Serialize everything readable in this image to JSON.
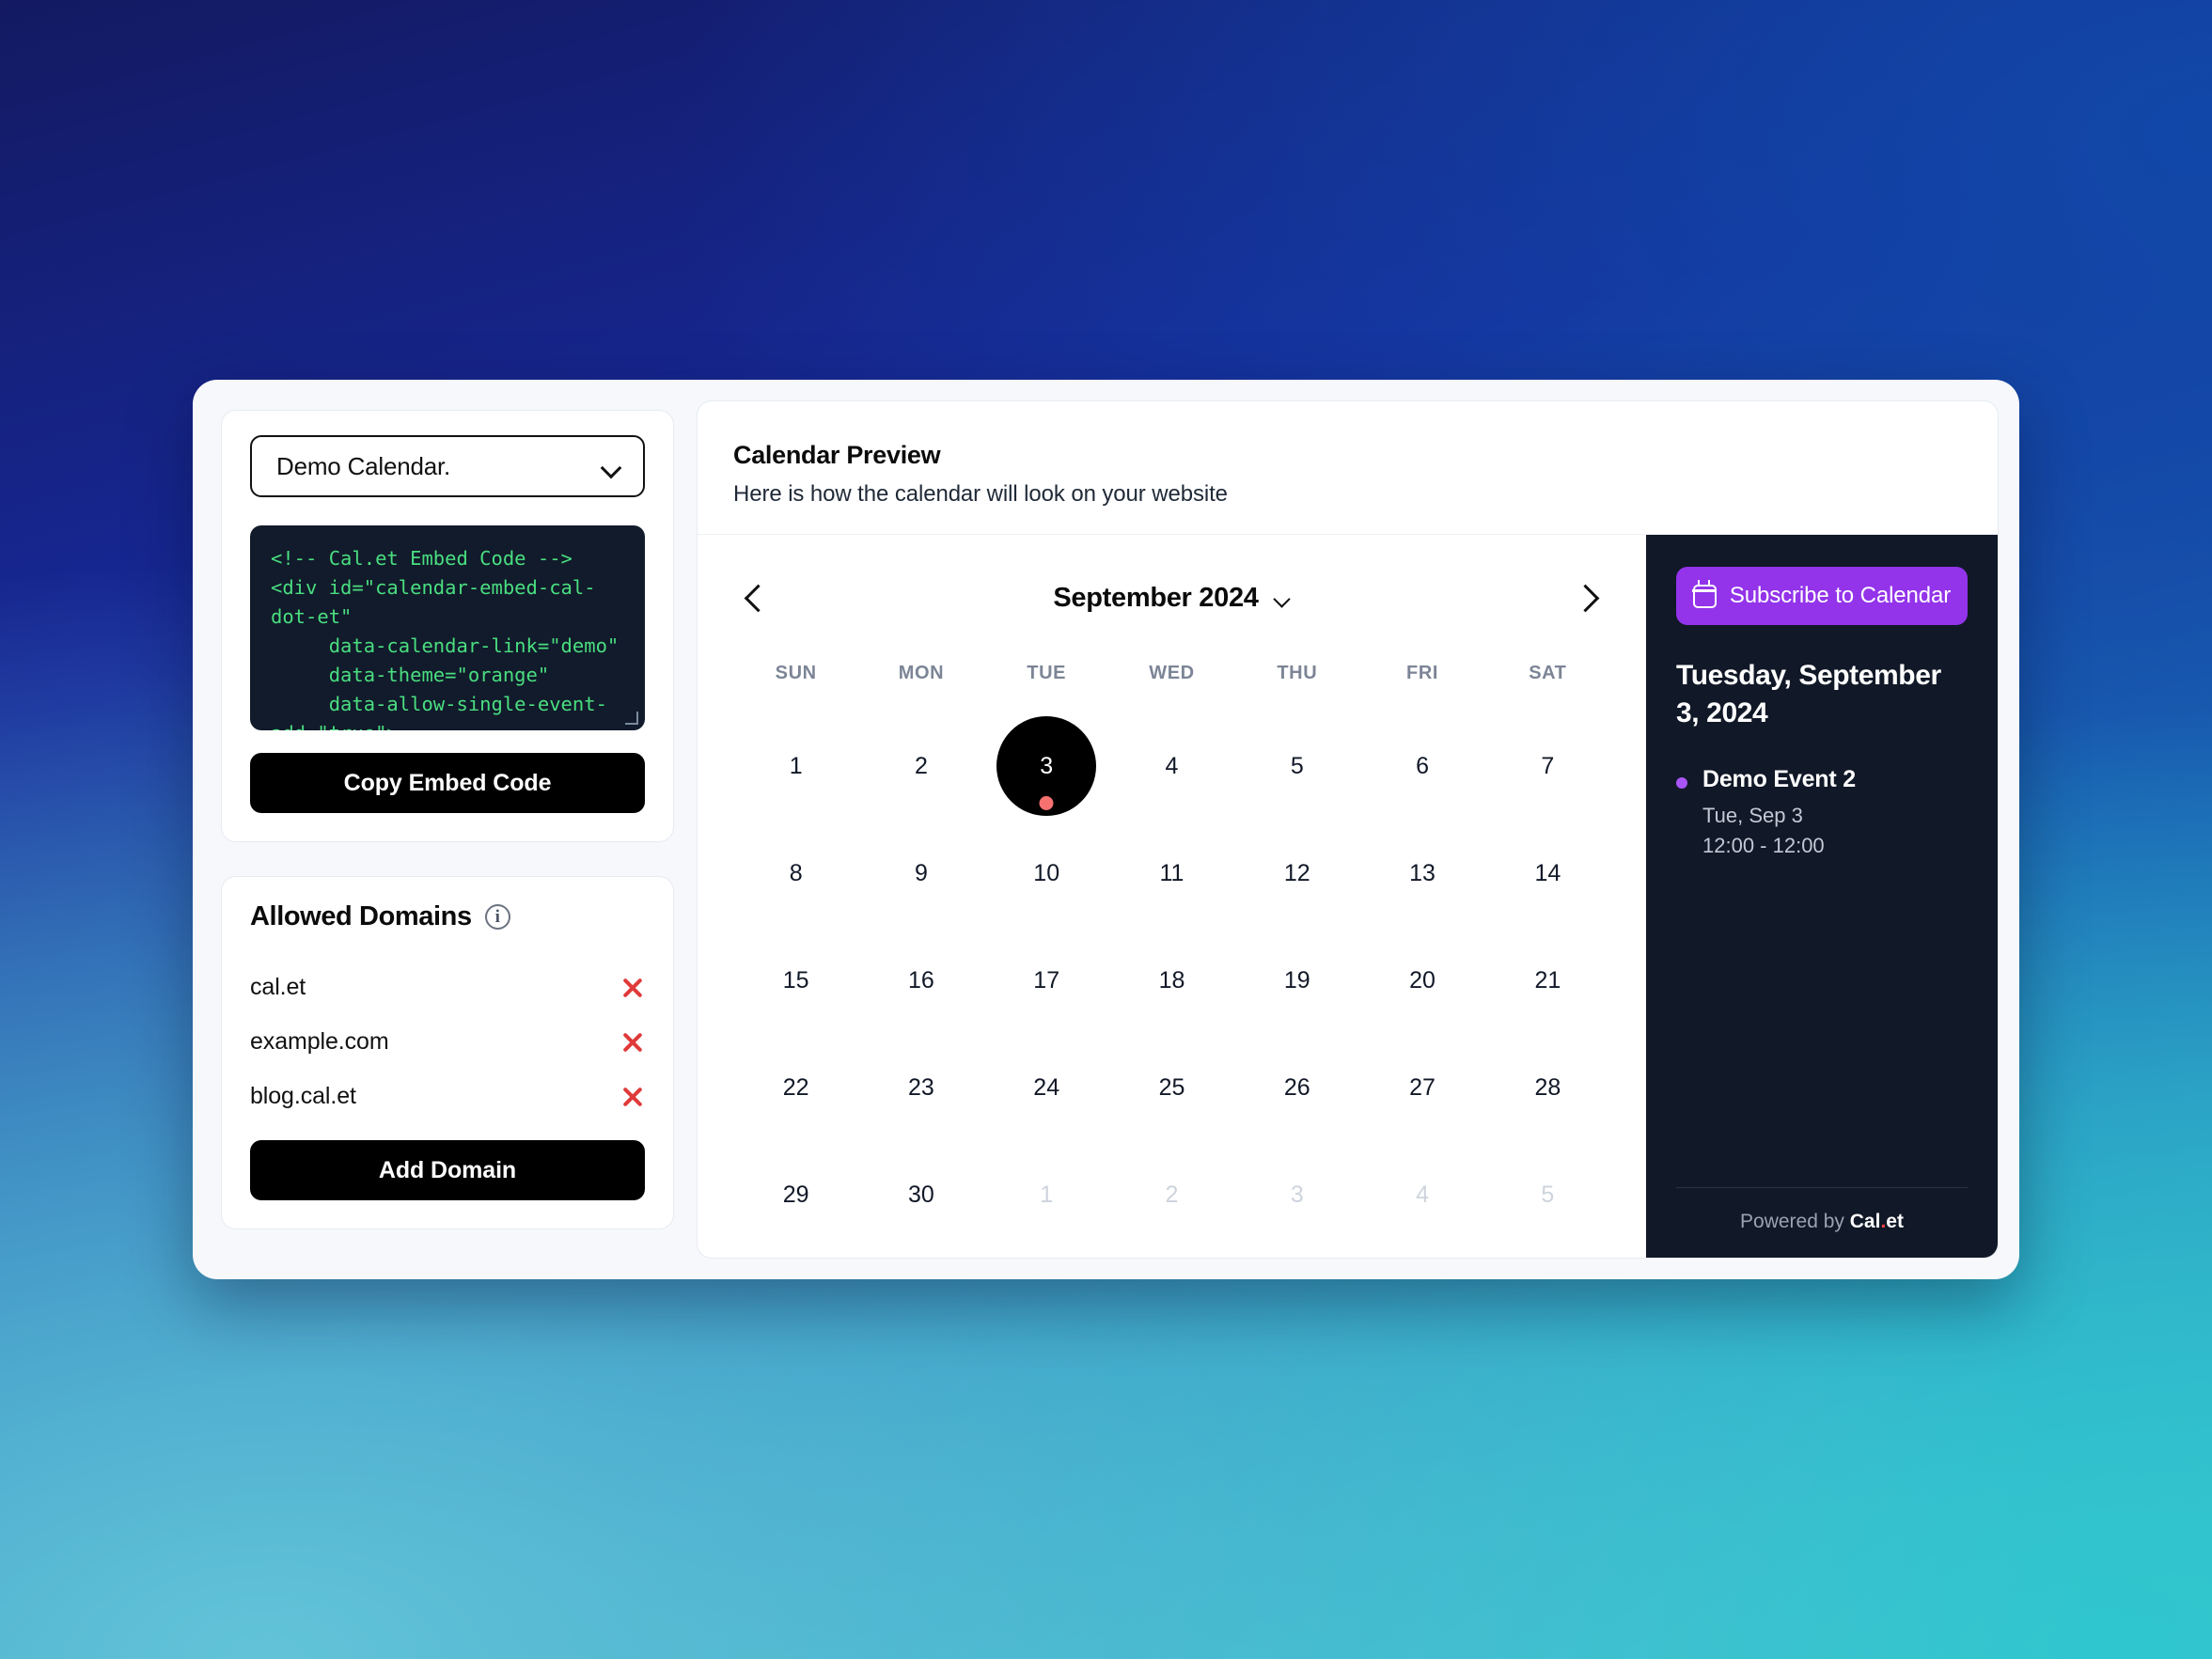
{
  "background": {
    "gradient_from": "#131a62",
    "gradient_via": "#1148a8",
    "gradient_to": "#3cc2cb"
  },
  "sidebar": {
    "calendar_select": {
      "value": "Demo Calendar.",
      "chevron_icon": "chevron-down-icon"
    },
    "embed_code": "<!-- Cal.et Embed Code -->\n<div id=\"calendar-embed-cal-\ndot-et\"\n     data-calendar-link=\"demo\"\n     data-theme=\"orange\"\n     data-allow-single-event-\nadd=\"true\">",
    "copy_button_label": "Copy Embed Code",
    "allowed_domains": {
      "title": "Allowed Domains",
      "info_icon": "info-icon",
      "items": [
        {
          "domain": "cal.et",
          "remove_icon": "x-icon"
        },
        {
          "domain": "example.com",
          "remove_icon": "x-icon"
        },
        {
          "domain": "blog.cal.et",
          "remove_icon": "x-icon"
        }
      ],
      "add_button_label": "Add Domain"
    }
  },
  "preview": {
    "title": "Calendar Preview",
    "subtitle": "Here is how the calendar will look on your website",
    "calendar": {
      "prev_icon": "chevron-left-icon",
      "next_icon": "chevron-right-icon",
      "month_label": "September 2024",
      "month_chevron_icon": "chevron-down-icon",
      "day_headers": [
        "SUN",
        "MON",
        "TUE",
        "WED",
        "THU",
        "FRI",
        "SAT"
      ],
      "weeks": [
        [
          {
            "day": "1",
            "muted": false,
            "selected": false,
            "has_event": false
          },
          {
            "day": "2",
            "muted": false,
            "selected": false,
            "has_event": false
          },
          {
            "day": "3",
            "muted": false,
            "selected": true,
            "has_event": true
          },
          {
            "day": "4",
            "muted": false,
            "selected": false,
            "has_event": false
          },
          {
            "day": "5",
            "muted": false,
            "selected": false,
            "has_event": false
          },
          {
            "day": "6",
            "muted": false,
            "selected": false,
            "has_event": false
          },
          {
            "day": "7",
            "muted": false,
            "selected": false,
            "has_event": false
          }
        ],
        [
          {
            "day": "8",
            "muted": false,
            "selected": false,
            "has_event": false
          },
          {
            "day": "9",
            "muted": false,
            "selected": false,
            "has_event": false
          },
          {
            "day": "10",
            "muted": false,
            "selected": false,
            "has_event": false
          },
          {
            "day": "11",
            "muted": false,
            "selected": false,
            "has_event": false
          },
          {
            "day": "12",
            "muted": false,
            "selected": false,
            "has_event": false
          },
          {
            "day": "13",
            "muted": false,
            "selected": false,
            "has_event": false
          },
          {
            "day": "14",
            "muted": false,
            "selected": false,
            "has_event": false
          }
        ],
        [
          {
            "day": "15",
            "muted": false,
            "selected": false,
            "has_event": false
          },
          {
            "day": "16",
            "muted": false,
            "selected": false,
            "has_event": false
          },
          {
            "day": "17",
            "muted": false,
            "selected": false,
            "has_event": false
          },
          {
            "day": "18",
            "muted": false,
            "selected": false,
            "has_event": false
          },
          {
            "day": "19",
            "muted": false,
            "selected": false,
            "has_event": false
          },
          {
            "day": "20",
            "muted": false,
            "selected": false,
            "has_event": false
          },
          {
            "day": "21",
            "muted": false,
            "selected": false,
            "has_event": false
          }
        ],
        [
          {
            "day": "22",
            "muted": false,
            "selected": false,
            "has_event": false
          },
          {
            "day": "23",
            "muted": false,
            "selected": false,
            "has_event": false
          },
          {
            "day": "24",
            "muted": false,
            "selected": false,
            "has_event": false
          },
          {
            "day": "25",
            "muted": false,
            "selected": false,
            "has_event": false
          },
          {
            "day": "26",
            "muted": false,
            "selected": false,
            "has_event": false
          },
          {
            "day": "27",
            "muted": false,
            "selected": false,
            "has_event": false
          },
          {
            "day": "28",
            "muted": false,
            "selected": false,
            "has_event": false
          }
        ],
        [
          {
            "day": "29",
            "muted": false,
            "selected": false,
            "has_event": false
          },
          {
            "day": "30",
            "muted": false,
            "selected": false,
            "has_event": false
          },
          {
            "day": "1",
            "muted": true,
            "selected": false,
            "has_event": false
          },
          {
            "day": "2",
            "muted": true,
            "selected": false,
            "has_event": false
          },
          {
            "day": "3",
            "muted": true,
            "selected": false,
            "has_event": false
          },
          {
            "day": "4",
            "muted": true,
            "selected": false,
            "has_event": false
          },
          {
            "day": "5",
            "muted": true,
            "selected": false,
            "has_event": false
          }
        ]
      ],
      "event_dot_color": "#f87171"
    },
    "side_panel": {
      "subscribe_label": "Subscribe to Calendar",
      "subscribe_icon": "calendar-icon",
      "subscribe_color": "#9333ea",
      "selected_date": "Tuesday, September 3, 2024",
      "events": [
        {
          "title": "Demo Event 2",
          "date": "Tue, Sep 3",
          "time": "12:00 - 12:00",
          "dot_color": "#a855f7"
        }
      ],
      "footer": {
        "prefix": "Powered by ",
        "brand_a": "Cal",
        "brand_dot": ".",
        "brand_b": "et"
      }
    }
  }
}
